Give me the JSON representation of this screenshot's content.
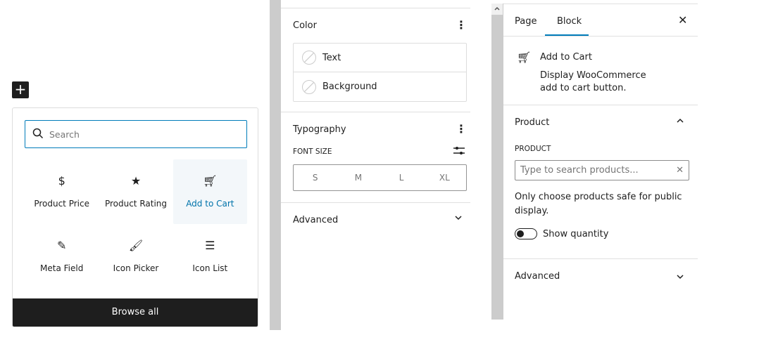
{
  "inserter": {
    "search_placeholder": "Search",
    "browse_all": "Browse all",
    "blocks": [
      {
        "label": "Product Price",
        "icon": "dollar-circle-icon"
      },
      {
        "label": "Product Rating",
        "icon": "star-icon"
      },
      {
        "label": "Add to Cart",
        "icon": "cart-icon",
        "selected": true
      },
      {
        "label": "Meta Field",
        "icon": "edit-icon"
      },
      {
        "label": "Icon Picker",
        "icon": "brush-icon"
      },
      {
        "label": "Icon List",
        "icon": "list-icon"
      }
    ]
  },
  "styles": {
    "color_title": "Color",
    "color_items": [
      "Text",
      "Background"
    ],
    "typography_title": "Typography",
    "font_size_label": "FONT SIZE",
    "sizes": [
      "S",
      "M",
      "L",
      "XL"
    ],
    "advanced": "Advanced"
  },
  "sidebar": {
    "tabs": [
      "Page",
      "Block"
    ],
    "block_title": "Add to Cart",
    "block_desc": "Display WooCommerce add to cart button.",
    "product_section": "Product",
    "product_label": "PRODUCT",
    "product_placeholder": "Type to search products...",
    "help": "Only choose products safe for public display.",
    "toggle_label": "Show quantity",
    "advanced": "Advanced"
  },
  "colors": {
    "accent": "#007cba"
  }
}
